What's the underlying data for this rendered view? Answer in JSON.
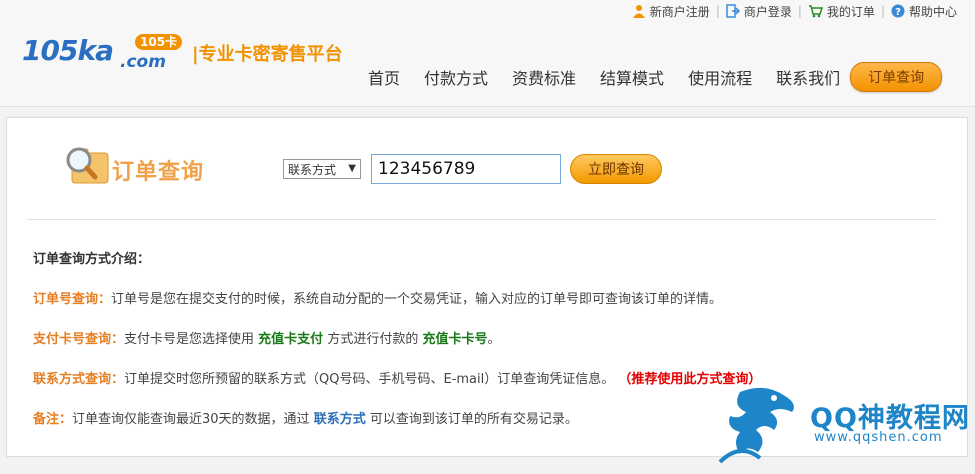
{
  "header": {
    "top_links": [
      {
        "label": "新商户注册",
        "icon": "user-icon"
      },
      {
        "label": "商户登录",
        "icon": "login-icon"
      },
      {
        "label": "我的订单",
        "icon": "cart-icon"
      },
      {
        "label": "帮助中心",
        "icon": "help-icon"
      }
    ],
    "logo": {
      "text": "105ka",
      "domain": ".com",
      "badge": "105卡",
      "slogan": "|专业卡密寄售平台"
    },
    "nav": [
      "首页",
      "付款方式",
      "资费标准",
      "结算模式",
      "使用流程",
      "联系我们"
    ],
    "order_button": "订单查询",
    "colors": {
      "accent": "#f39200",
      "brand_blue": "#2b6fc2"
    }
  },
  "query": {
    "title": "订单查询",
    "select_value": "联系方式",
    "input_value": "123456789",
    "button": "立即查询"
  },
  "info": {
    "intro": "订单查询方式介绍：",
    "order_no": {
      "label": "订单号查询：",
      "text": "订单号是您在提交支付的时候，系统自动分配的一个交易凭证，输入对应的订单号即可查询该订单的详情。"
    },
    "card_no": {
      "label": "支付卡号查询：",
      "t1": "支付卡号是您选择使用",
      "g1": "充值卡支付",
      "t2": "方式进行付款的",
      "g2": "充值卡卡号",
      "t3": "。"
    },
    "contact": {
      "label": "联系方式查询：",
      "text": "订单提交时您所预留的联系方式（QQ号码、手机号码、E-mail）订单查询凭证信息。",
      "red": "（推荐使用此方式查询）"
    },
    "note": {
      "label": "备注：",
      "t1": "订单查询仅能查询最近30天的数据，通过",
      "b1": "联系方式",
      "t2": "可以查询到该订单的所有交易记录。"
    }
  },
  "watermark": {
    "title": "QQ神教程网",
    "url": "www.qqshen.com"
  }
}
